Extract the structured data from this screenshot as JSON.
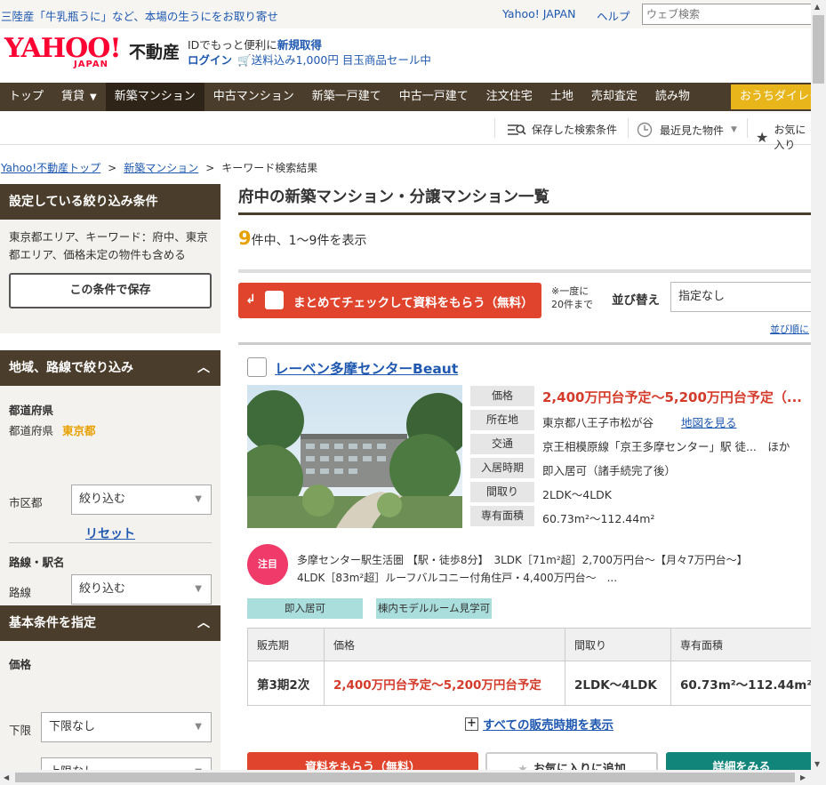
{
  "topbar": {
    "promo": "三陸産「牛乳瓶うに」など、本場の生うにをお取り寄せ",
    "yahoo_japan": "Yahoo! JAPAN",
    "help": "ヘルプ",
    "search_placeholder": "ウェブ検索"
  },
  "header": {
    "logo_yahoo": "YAHOO!",
    "logo_japan": "JAPAN",
    "logo_fudosan": "不動産",
    "msg1_a": "IDでもっと便利に",
    "msg1_b": "新規取得",
    "login": "ログイン",
    "sale": "送料込み1,000円 目玉商品セール中"
  },
  "nav": {
    "items": [
      "トップ",
      "賃貸",
      "新築マンション",
      "中古マンション",
      "新築一戸建て",
      "中古一戸建て",
      "注文住宅",
      "土地",
      "売却査定",
      "読み物"
    ],
    "ouchi": "おうちダイレクト"
  },
  "util": {
    "saved": "保存した検索条件",
    "recent": "最近見た物件",
    "fav": "お気に入り"
  },
  "breadcrumb": {
    "top": "Yahoo!不動産トップ",
    "mansion": "新築マンション",
    "current": "キーワード検索結果"
  },
  "sidebar": {
    "cond_title": "設定している絞り込み条件",
    "cond_text": "東京都エリア、キーワード：府中、東京都エリア、価格未定の物件も含める",
    "save_btn": "この条件で保存",
    "area_title": "地域、路線で絞り込み",
    "pref_label": "都道府県",
    "pref_row_label": "都道府県",
    "pref_value": "東京都",
    "city_label": "市区都",
    "city_select": "絞り込む",
    "reset": "リセット",
    "line_label": "路線・駅名",
    "line_row_label": "路線",
    "line_select": "絞り込む",
    "basic_title": "基本条件を指定",
    "price_label": "価格",
    "min_label": "下限",
    "min_value": "下限なし",
    "max_label": "上限",
    "max_value": "上限なし"
  },
  "main": {
    "title": "府中の新築マンション・分譲マンション一覧",
    "count_num": "9",
    "count_text": "件中、1〜9件を表示",
    "bulk_btn": "まとめてチェックして資料をもらう（無料）",
    "bulk_note1": "※一度に",
    "bulk_note2": "20件まで",
    "sort_label": "並び替え",
    "sort_value": "指定なし",
    "sort_link": "並び順に"
  },
  "property": {
    "name": "レーベン多摩センターBeaut",
    "specs": [
      {
        "k": "価格",
        "v": "2,400万円台予定〜5,200万円台予定（..."
      },
      {
        "k": "所在地",
        "v": "東京都八王子市松が谷"
      },
      {
        "k": "交通",
        "v": "京王相模原線「京王多摩センター」駅 徒...　ほか"
      },
      {
        "k": "入居時期",
        "v": "即入居可（諸手続完了後）"
      },
      {
        "k": "間取り",
        "v": "2LDK〜4LDK"
      },
      {
        "k": "専有面積",
        "v": "60.73m²〜112.44m²"
      }
    ],
    "map_link": "地図を見る",
    "badge": "注目",
    "feature": "多摩センター駅生活圏 【駅・徒歩8分】　3LDK［71m²超］2,700万円台〜【月々7万円台〜】　4LDK［83m²超］ルーフバルコニー付角住戸・4,400万円台〜　...",
    "tags": [
      "即入居可",
      "棟内モデルルーム見学可"
    ],
    "table_headers": [
      "販売期",
      "価格",
      "間取り",
      "専有面積"
    ],
    "table_row": [
      "第3期2次",
      "2,400万円台予定〜5,200万円台予定",
      "2LDK〜4LDK",
      "60.73m²〜112.44m²"
    ],
    "all_periods": "すべての販売時期を表示",
    "btn_request": "資料をもらう（無料）",
    "btn_fav": "お気に入りに追加",
    "btn_detail": "詳細をみる"
  },
  "colors": {
    "nav_bg": "#4b3d2b",
    "accent_red": "#e0442d",
    "price_red": "#d43b2b",
    "link_blue": "#1e58b0",
    "count_orange": "#e8a000",
    "tag_teal": "#a9dedd"
  }
}
